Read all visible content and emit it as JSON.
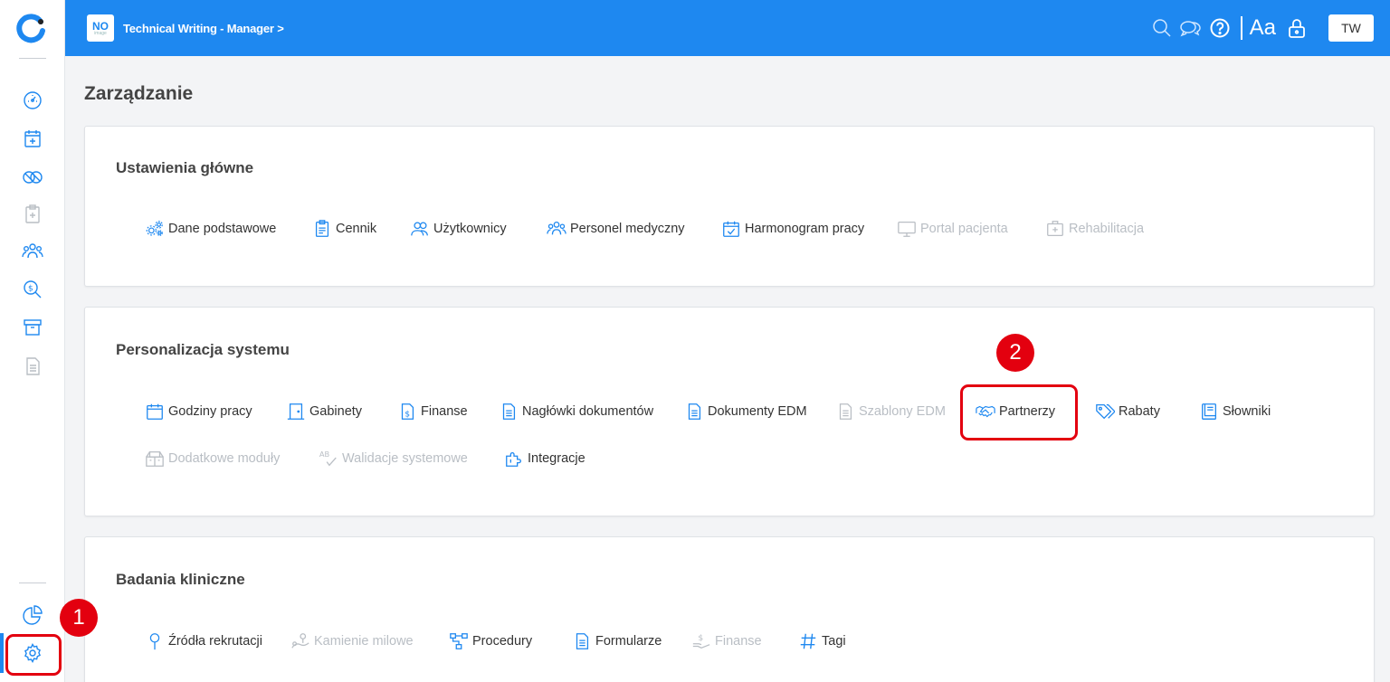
{
  "header": {
    "badge_text": "NO",
    "badge_sub": "image",
    "title": "Technical Writing - Manager",
    "title_chevron": ">",
    "font_size_label": "Aa",
    "user_initials": "TW",
    "icons": [
      "search-icon",
      "chat-icon",
      "help-icon",
      "font-size-icon",
      "lock-icon"
    ]
  },
  "sidebar": {
    "items": [
      {
        "name": "dashboard-icon"
      },
      {
        "name": "calendar-icon"
      },
      {
        "name": "pills-icon"
      },
      {
        "name": "clipboard-icon"
      },
      {
        "name": "patients-icon"
      },
      {
        "name": "billing-search-icon"
      },
      {
        "name": "archive-icon"
      },
      {
        "name": "document-icon"
      },
      {
        "name": "reports-icon"
      },
      {
        "name": "settings-icon"
      }
    ]
  },
  "page": {
    "title": "Zarządzanie"
  },
  "sections": [
    {
      "title": "Ustawienia główne",
      "items": [
        {
          "label": "Dane podstawowe",
          "icon": "gears-icon",
          "disabled": false
        },
        {
          "label": "Cennik",
          "icon": "price-list-icon",
          "disabled": false
        },
        {
          "label": "Użytkownicy",
          "icon": "users-icon",
          "disabled": false
        },
        {
          "label": "Personel medyczny",
          "icon": "staff-icon",
          "disabled": false
        },
        {
          "label": "Harmonogram pracy",
          "icon": "calendar-check-icon",
          "disabled": false
        },
        {
          "label": "Portal pacjenta",
          "icon": "monitor-icon",
          "disabled": true
        },
        {
          "label": "Rehabilitacja",
          "icon": "medical-plus-icon",
          "disabled": true
        }
      ]
    },
    {
      "title": "Personalizacja systemu",
      "items": [
        {
          "label": "Godziny pracy",
          "icon": "calendar-icon",
          "disabled": false
        },
        {
          "label": "Gabinety",
          "icon": "door-icon",
          "disabled": false
        },
        {
          "label": "Finanse",
          "icon": "dollar-doc-icon",
          "disabled": false
        },
        {
          "label": "Nagłówki dokumentów",
          "icon": "doc-icon",
          "disabled": false
        },
        {
          "label": "Dokumenty EDM",
          "icon": "doc-icon",
          "disabled": false
        },
        {
          "label": "Szablony EDM",
          "icon": "doc-icon",
          "disabled": true
        },
        {
          "label": "Partnerzy",
          "icon": "handshake-icon",
          "disabled": false
        },
        {
          "label": "Rabaty",
          "icon": "tags-icon",
          "disabled": false
        },
        {
          "label": "Słowniki",
          "icon": "book-icon",
          "disabled": false
        },
        {
          "label": "Dodatkowe moduły",
          "icon": "modules-icon",
          "disabled": true
        },
        {
          "label": "Walidacje systemowe",
          "icon": "spellcheck-icon",
          "disabled": true
        },
        {
          "label": "Integracje",
          "icon": "puzzle-icon",
          "disabled": false
        }
      ]
    },
    {
      "title": "Badania kliniczne",
      "items": [
        {
          "label": "Źródła rekrutacji",
          "icon": "pin-icon",
          "disabled": false
        },
        {
          "label": "Kamienie milowe",
          "icon": "milestone-icon",
          "disabled": true
        },
        {
          "label": "Procedury",
          "icon": "flow-icon",
          "disabled": false
        },
        {
          "label": "Formularze",
          "icon": "doc-icon",
          "disabled": false
        },
        {
          "label": "Finanse",
          "icon": "hand-money-icon",
          "disabled": true
        },
        {
          "label": "Tagi",
          "icon": "hash-icon",
          "disabled": false
        }
      ]
    }
  ],
  "annotations": [
    {
      "label": "1",
      "target": "settings"
    },
    {
      "label": "2",
      "target": "Partnerzy"
    }
  ],
  "colors": {
    "accent": "#1e88f0",
    "annotation": "#e3000f",
    "disabled": "#b9bec4"
  }
}
